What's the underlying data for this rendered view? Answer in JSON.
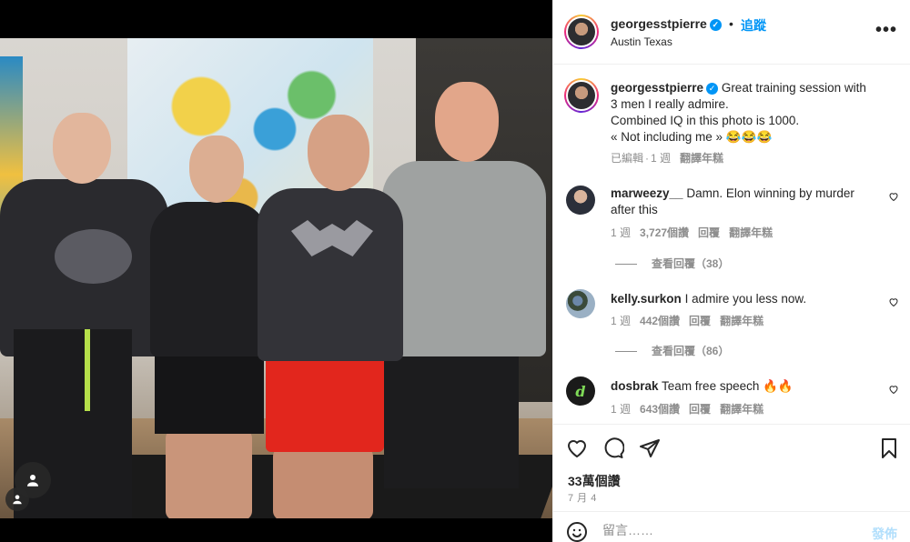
{
  "post": {
    "username": "georgesstpierre",
    "follow_label": "追蹤",
    "dot": "•",
    "location": "Austin Texas",
    "more_label": "•••"
  },
  "caption": {
    "username": "georgesstpierre",
    "text_line1": "Great training session with",
    "text_line2": "3 men I really admire.",
    "text_line3": "Combined IQ in this photo is 1000.",
    "text_line4": "« Not including me » 😂😂😂",
    "edited": "已編輯",
    "dot": "·",
    "age": "1 週",
    "translate": "翻譯年糕"
  },
  "comments": [
    {
      "username": "marweezy__",
      "text": "Damn. Elon winning by murder after this",
      "age": "1 週",
      "likes": "3,727個讚",
      "reply": "回覆",
      "translate": "翻譯年糕",
      "view_replies": "查看回覆（38）"
    },
    {
      "username": "kelly.surkon",
      "text": "I admire you less now.",
      "age": "1 週",
      "likes": "442個讚",
      "reply": "回覆",
      "translate": "翻譯年糕",
      "view_replies": "查看回覆（86）"
    },
    {
      "username": "dosbrak",
      "text": "Team free speech 🔥🔥",
      "age": "1 週",
      "likes": "643個讚",
      "reply": "回覆",
      "translate": "翻譯年糕"
    }
  ],
  "actions": {
    "like_count": "33萬個讚",
    "date": "7 月 4"
  },
  "compose": {
    "placeholder": "留言……",
    "post_label": "發佈"
  },
  "colors": {
    "link_blue": "#0095f6",
    "muted_gray": "#8e8e8e",
    "post_disabled": "#b2dffc"
  },
  "icons": [
    "heart-icon",
    "comment-icon",
    "share-icon",
    "bookmark-icon",
    "emoji-icon",
    "more-icon",
    "verified-icon",
    "user-tag-icon"
  ]
}
